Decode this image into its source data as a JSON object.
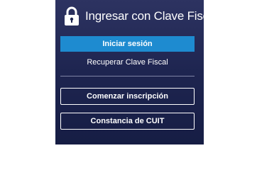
{
  "header": {
    "title": "Ingresar con Clave Fiscal",
    "icon": "lock-icon"
  },
  "login": {
    "primary_label": "Iniciar sesión",
    "recover_label": "Recuperar Clave Fiscal"
  },
  "actions": {
    "inscripcion_label": "Comenzar inscripción",
    "constancia_label": "Constancia de CUIT"
  },
  "colors": {
    "panel_bg": "#1e2550",
    "primary_button": "#1e8bd0",
    "text": "#ffffff"
  }
}
